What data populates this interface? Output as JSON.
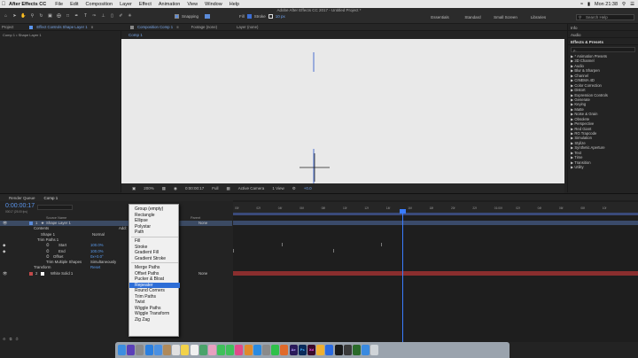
{
  "menubar": {
    "apple_icon": "apple-icon",
    "app_name": "After Effects CC",
    "items": [
      "File",
      "Edit",
      "Composition",
      "Layer",
      "Effect",
      "Animation",
      "View",
      "Window",
      "Help"
    ],
    "clock": "Mon 21:38"
  },
  "window": {
    "title": "Adobe After Effects CC 2017 - Untitled Project *"
  },
  "toolbar": {
    "snapping_label": "Snapping",
    "fill_label": "Fill",
    "stroke_label": "Stroke",
    "stroke_width": "10 px"
  },
  "workspaces": [
    "Essentials",
    "Standard",
    "Small Screen",
    "Libraries"
  ],
  "help_search": {
    "placeholder": "Search Help"
  },
  "left_panel": {
    "tabs": [
      "Project",
      "Effect Controls Shape Layer 1"
    ],
    "breadcrumb": "Comp 1 • Shape Layer 1"
  },
  "viewer": {
    "tabs": [
      "Composition Comp 1",
      "Footage (none)",
      "Layer (none)"
    ],
    "sub_tab": "Comp 1",
    "bottom": {
      "zoom": "200%",
      "timecode": "0:00:00:17",
      "resolution": "Full",
      "camera": "Active Camera",
      "views": "1 View",
      "exposure": "+0.0"
    }
  },
  "right_panel": {
    "info": "Info",
    "audio": "Audio",
    "effects_title": "Effects & Presets",
    "search_value": "ρ-",
    "categories": [
      "* Animation Presets",
      "3D Channel",
      "Audio",
      "Blur & Sharpen",
      "Channel",
      "CINEMA 4D",
      "Color Correction",
      "Distort",
      "Expression Controls",
      "Generate",
      "Keying",
      "Matte",
      "Noise & Grain",
      "Obsolete",
      "Perspective",
      "Red Giant",
      "RG Trapcode",
      "Simulation",
      "Stylize",
      "Synthetic Aperture",
      "Text",
      "Time",
      "Transition",
      "Utility"
    ]
  },
  "timeline": {
    "tabs": [
      "Render Queue",
      "Comp 1"
    ],
    "timecode": "0:00:00:17",
    "fps": "00017 (25.00 fps)",
    "columns": {
      "source": "Source Name",
      "parent": "Parent"
    },
    "add_label": "Add:",
    "layers": [
      {
        "num": "1",
        "name": "Shape Layer 1",
        "parent": "None"
      },
      {
        "num": "2",
        "name": "White Solid 1",
        "parent": "None"
      }
    ],
    "props": {
      "contents": "Contents",
      "shape1": "Shape 1",
      "shape1_mode": "Normal",
      "trim": "Trim Paths 1",
      "start": "Start",
      "start_val": "100.0%",
      "end": "End",
      "end_val": "100.0%",
      "offset": "Offset",
      "offset_val": "0x+0.0°",
      "trim_multi": "Trim Multiple Shapes",
      "trim_multi_val": "Simultaneously",
      "transform": "Transform",
      "reset": "Reset"
    },
    "ruler": [
      "00f",
      "02f",
      "04f",
      "06f",
      "08f",
      "10f",
      "12f",
      "14f",
      "16f",
      "18f",
      "20f",
      "22f",
      "01:00f",
      "02f",
      "04f",
      "06f",
      "08f",
      "10f"
    ]
  },
  "add_menu": {
    "items": [
      "Group (empty)",
      "Rectangle",
      "Ellipse",
      "Polystar",
      "Path",
      "Fill",
      "Stroke",
      "Gradient Fill",
      "Gradient Stroke",
      "Merge Paths",
      "Offset Paths",
      "Pucker & Bloat",
      "Repeater",
      "Round Corners",
      "Trim Paths",
      "Twist",
      "Wiggle Paths",
      "Wiggle Transform",
      "Zig Zag"
    ],
    "highlighted": "Repeater"
  },
  "dock": {
    "apps": [
      "finder-icon",
      "siri-icon",
      "launchpad-icon",
      "safari-icon",
      "mail-icon",
      "contacts-icon",
      "calendar-icon",
      "notes-icon",
      "reminders-icon",
      "maps-icon",
      "photos-icon",
      "messages-icon",
      "facetime-icon",
      "itunes-icon",
      "ibooks-icon",
      "appstore-icon",
      "preferences-icon",
      "line-icon",
      "firefox-icon",
      "ae-icon",
      "ps-icon",
      "xd-icon",
      "sketch-icon",
      "xcode-icon",
      "terminal-icon",
      "quicktime-icon",
      "monitor-icon",
      "downloads-icon",
      "trash-icon"
    ],
    "labels": {
      "ae": "Ae",
      "ps": "Ps",
      "xd": "Xd"
    }
  },
  "colors": {
    "accent_blue": "#5b95ec",
    "menu_highlight": "#2d6dd6",
    "solid_track": "#8a2e2e",
    "shape_track": "#3a4a6a"
  }
}
